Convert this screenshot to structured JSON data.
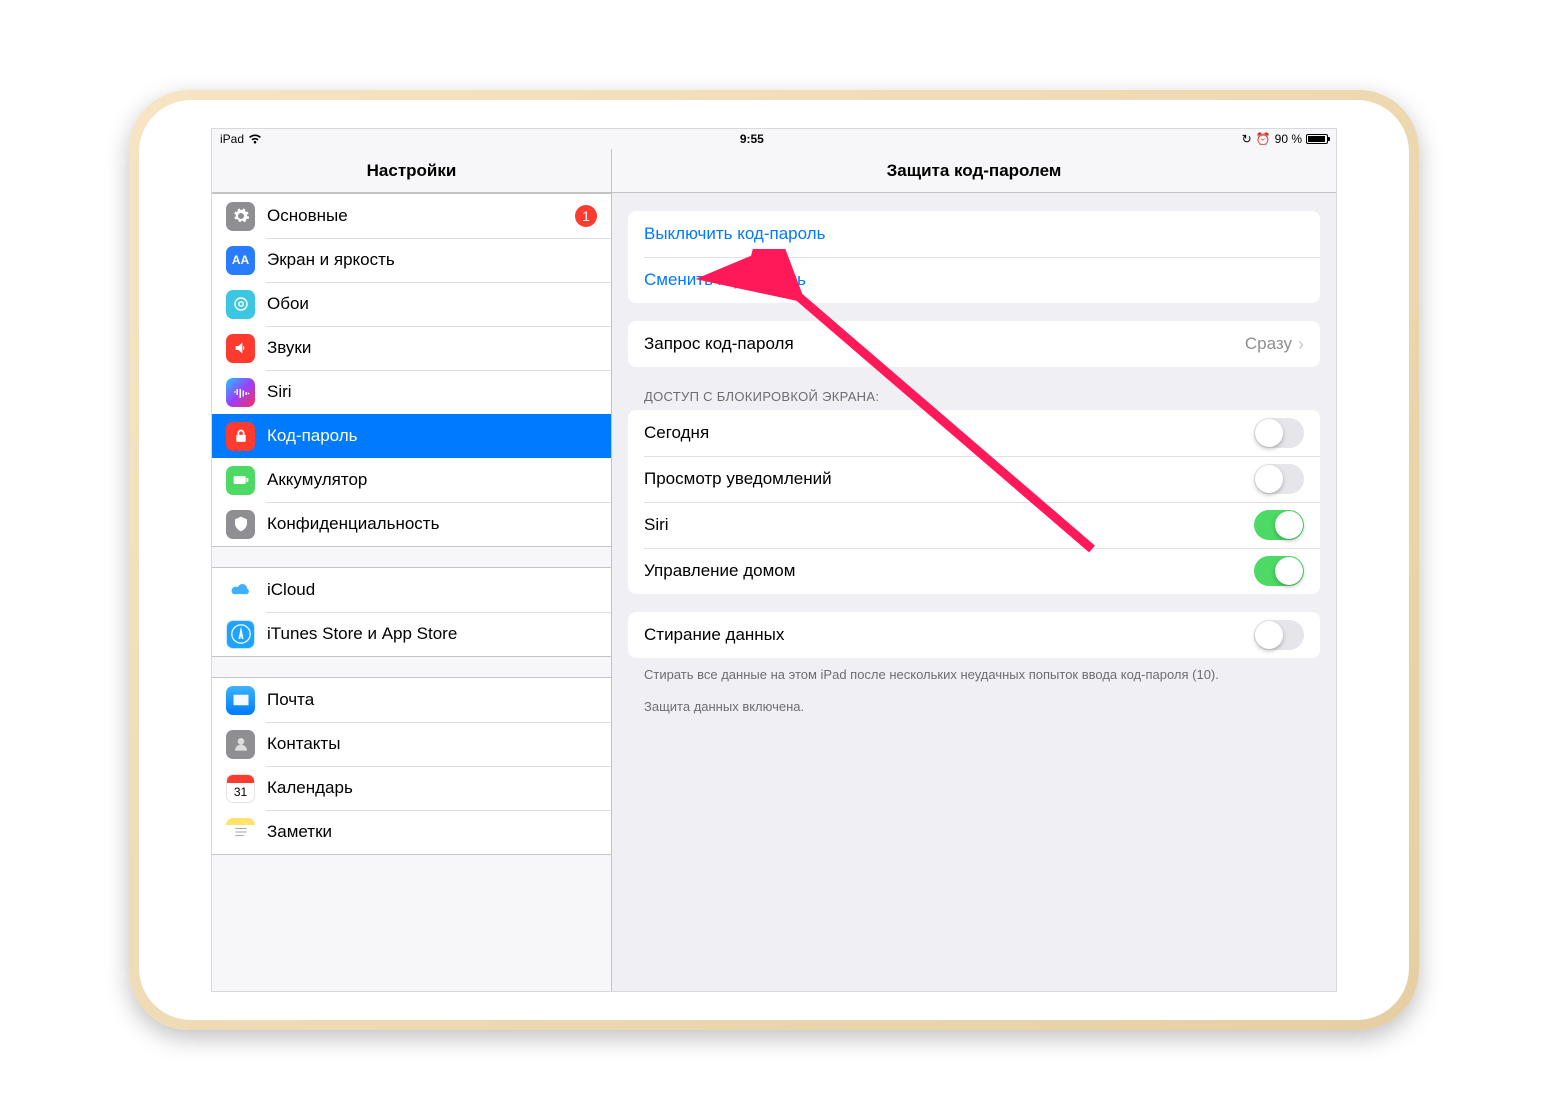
{
  "status": {
    "device": "iPad",
    "time": "9:55",
    "battery_pct": "90 %"
  },
  "sidebar": {
    "title": "Настройки",
    "groups": [
      [
        {
          "id": "general",
          "label": "Основные",
          "badge": "1"
        },
        {
          "id": "display",
          "label": "Экран и яркость"
        },
        {
          "id": "wallpaper",
          "label": "Обои"
        },
        {
          "id": "sounds",
          "label": "Звуки"
        },
        {
          "id": "siri",
          "label": "Siri"
        },
        {
          "id": "passcode",
          "label": "Код-пароль",
          "selected": true
        },
        {
          "id": "battery",
          "label": "Аккумулятор"
        },
        {
          "id": "privacy",
          "label": "Конфиденциальность"
        }
      ],
      [
        {
          "id": "icloud",
          "label": "iCloud"
        },
        {
          "id": "itunes",
          "label": "iTunes Store и App Store"
        }
      ],
      [
        {
          "id": "mail",
          "label": "Почта"
        },
        {
          "id": "contacts",
          "label": "Контакты"
        },
        {
          "id": "calendar",
          "label": "Календарь"
        },
        {
          "id": "notes",
          "label": "Заметки"
        }
      ]
    ]
  },
  "detail": {
    "title": "Защита код-паролем",
    "turn_off": "Выключить код-пароль",
    "change": "Сменить код-пароль",
    "require": {
      "label": "Запрос код-пароля",
      "value": "Сразу"
    },
    "lock_header": "ДОСТУП С БЛОКИРОВКОЙ ЭКРАНА:",
    "lock_items": [
      {
        "label": "Сегодня",
        "on": false
      },
      {
        "label": "Просмотр уведомлений",
        "on": false
      },
      {
        "label": "Siri",
        "on": true
      },
      {
        "label": "Управление домом",
        "on": true
      }
    ],
    "erase": {
      "label": "Стирание данных",
      "on": false
    },
    "erase_footer": "Стирать все данные на этом iPad после нескольких неудачных попыток ввода код-пароля (10).",
    "protection_footer": "Защита данных включена."
  }
}
